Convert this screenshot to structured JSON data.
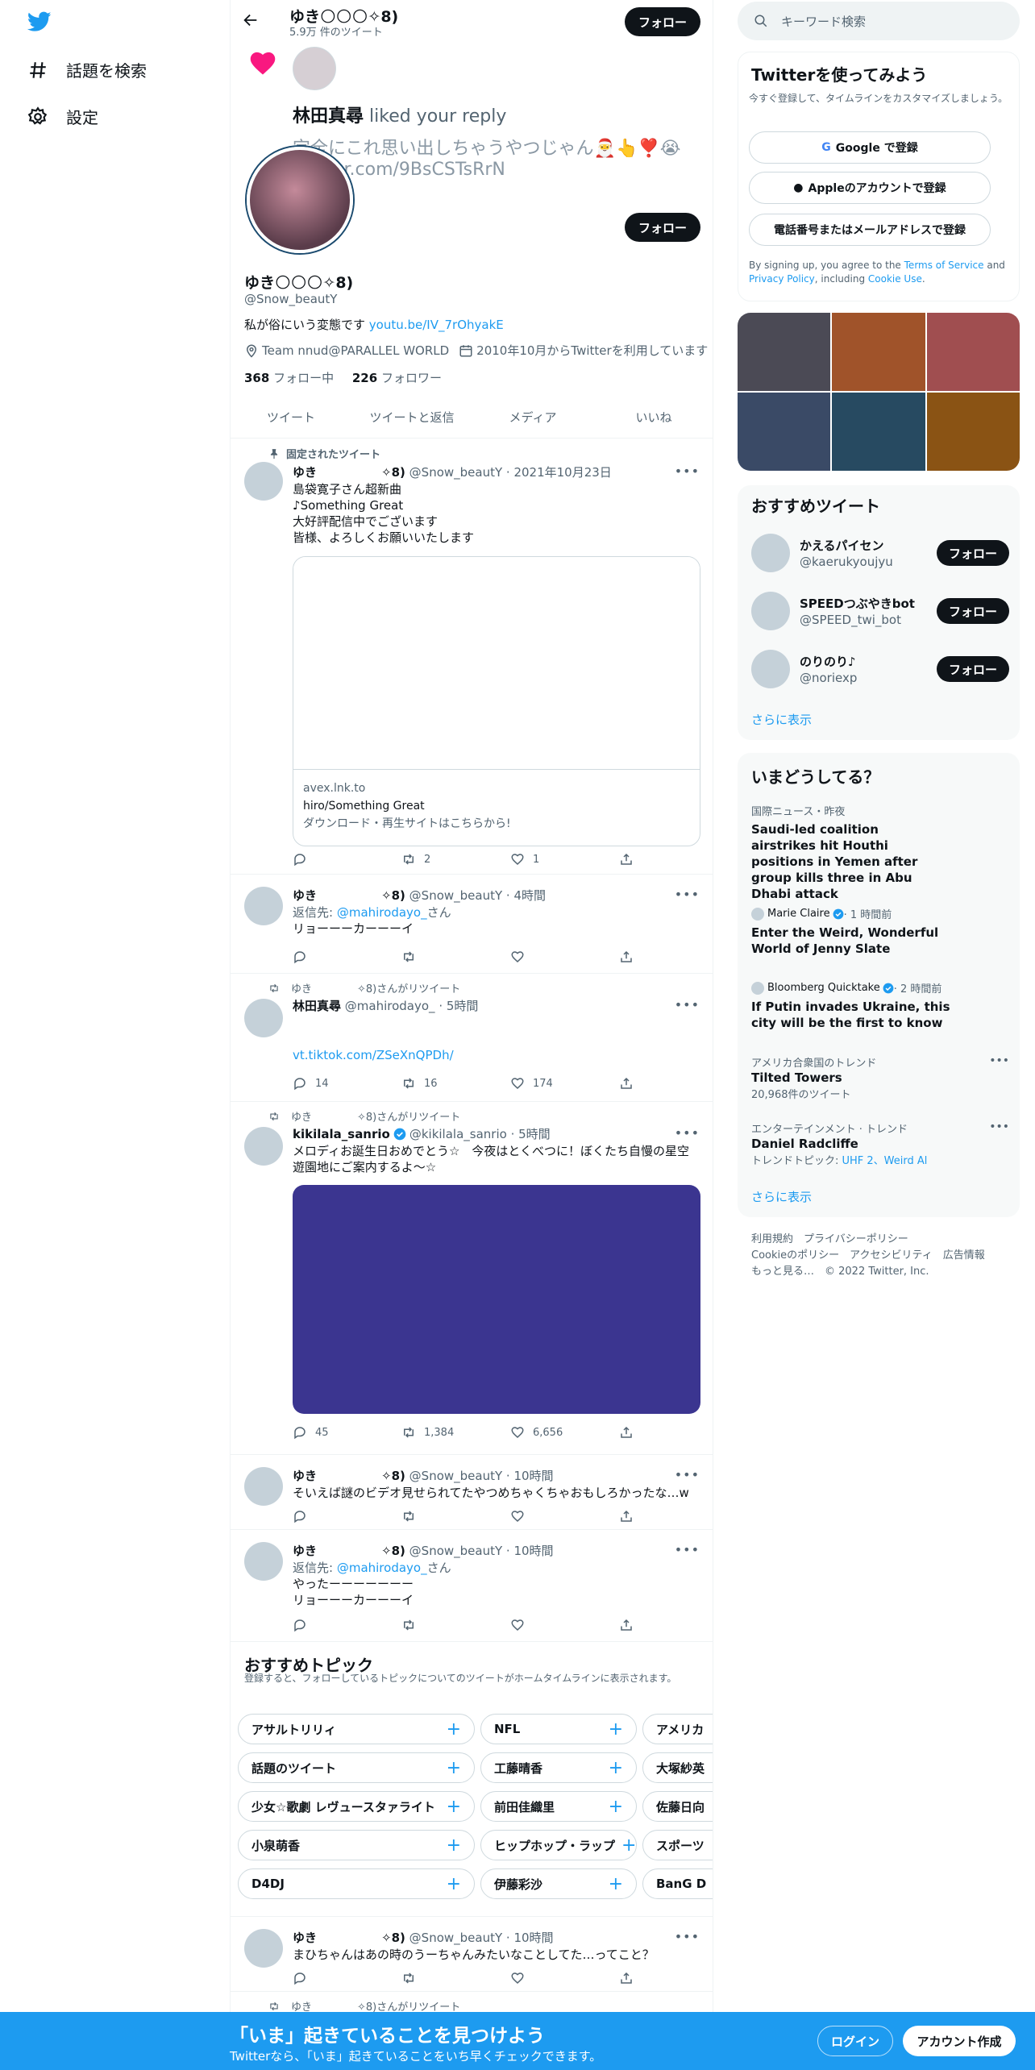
{
  "nav": {
    "explore_label": "話題を検索",
    "settings_label": "設定"
  },
  "profile": {
    "header_name": "ゆき🌕🌕🌕✧8)",
    "header_tweet_count": "5.9万 件のツイート",
    "follow_label": "フォロー",
    "notif_text_name": "林田真尋",
    "notif_text_rest": " liked your reply",
    "notif_tweet_text": "完全にこれ思い出しちゃうやつじゃん🎅👆❣️😭",
    "notif_link": "twitter.com/9BsCSTsRrN",
    "name": "ゆき🌕🌕🌕✧8)",
    "handle": "@Snow_beautY",
    "bio_text": "私が俗にいう変態です ",
    "bio_link": "youtu.be/IV_7rOhyakE",
    "location": "Team nnud@PARALLEL WORLD",
    "joined": "2010年10月からTwitterを利用しています",
    "following_count": "368",
    "following_label": " フォロー中",
    "followers_count": "226",
    "followers_label": " フォロワー"
  },
  "tabs": [
    "ツイート",
    "ツイートと返信",
    "メディア",
    "いいね"
  ],
  "tweets": {
    "pinned": {
      "pinned_label": "固定されたツイート",
      "name": "ゆき",
      "name_suffix": "✧8)",
      "handle_time": "@Snow_beautY · 2021年10月23日",
      "lines": [
        "島袋寛子さん超新曲",
        "♪Something Great",
        "大好評配信中でございます",
        "皆様、よろしくお願いいたします"
      ],
      "card_domain": "avex.lnk.to",
      "card_title": "hiro/Something Great",
      "card_desc": "ダウンロード・再生サイトはこちらから!",
      "retweets": "2",
      "likes": "1"
    },
    "t2": {
      "name": "ゆき",
      "name_suffix": "✧8)",
      "handle_time": "@Snow_beautY · 4時間",
      "reply_prefix": "返信先: ",
      "reply_to": "@mahirodayo_",
      "reply_suffix": "さん",
      "text": "リョーーーカーーーイ"
    },
    "t3": {
      "rt_label_a": "ゆき",
      "rt_label_b": "✧8)さんがリツイート",
      "name": "林田真尋",
      "handle_time": "@mahirodayo_ · 5時間",
      "link": "vt.tiktok.com/ZSeXnQPDh/",
      "replies": "14",
      "retweets": "16",
      "likes": "174"
    },
    "t4": {
      "rt_label_a": "ゆき",
      "rt_label_b": "✧8)さんがリツイート",
      "name": "kikilala_sanrio",
      "handle_time": "@kikilala_sanrio · 5時間",
      "line1": "メロディお誕生日おめでとう☆　今夜はとくべつに！ぼくたち自慢の星空",
      "line2": "遊園地にご案内するよ〜☆",
      "replies": "45",
      "retweets": "1,384",
      "likes": "6,656",
      "media_color": "#3b3590"
    },
    "t5": {
      "name": "ゆき",
      "name_suffix": "✧8)",
      "handle_time": "@Snow_beautY · 10時間",
      "text": "そいえば謎のビデオ見せられてたやつめちゃくちゃおもしろかったな…w"
    },
    "t6": {
      "name": "ゆき",
      "name_suffix": "✧8)",
      "handle_time": "@Snow_beautY · 10時間",
      "reply_prefix": "返信先: ",
      "reply_to": "@mahirodayo_",
      "reply_suffix": "さん",
      "line1": "やったーーーーーーー",
      "line2": "リョーーーカーーーイ"
    },
    "t7": {
      "name": "ゆき",
      "name_suffix": "✧8)",
      "handle_time": "@Snow_beautY · 10時間",
      "text": "まひちゃんはあの時のうーちゃんみたいなことしてた…ってこと？"
    },
    "t8": {
      "rt_label_a": "ゆき",
      "rt_label_b": "✧8)さんがリツイート"
    }
  },
  "topics": {
    "title": "おすすめトピック",
    "subtitle": "登録すると、フォローしているトピックについてのツイートがホームタイムラインに表示されます。",
    "col1": [
      "アサルトリリィ",
      "話題のツイート",
      "少女☆歌劇 レヴュースタァライト",
      "小泉萌香",
      "D4DJ"
    ],
    "col2": [
      "NFL",
      "工藤晴香",
      "前田佳織里",
      "ヒップホップ・ラップ",
      "伊藤彩沙"
    ],
    "col3": [
      "アメリカ",
      "大塚紗英",
      "佐藤日向",
      "スポーツ",
      "BanG D"
    ]
  },
  "right": {
    "search_placeholder": "キーワード検索",
    "signup_title": "Twitterを使ってみよう",
    "signup_sub": "今すぐ登録して、タイムラインをカスタマイズしましょう。",
    "google_btn": "Google で登録",
    "apple_btn": "Appleのアカウントで登録",
    "phone_btn": "電話番号またはメールアドレスで登録",
    "terms_a": "By signing up, you agree to the ",
    "terms_link1": "Terms of Service",
    "terms_b": " and ",
    "terms_link2": "Privacy Policy",
    "terms_c": ", including ",
    "terms_link3": "Cookie Use",
    "terms_d": ".",
    "media_colors": [
      "#4b4a55",
      "#a0532a",
      "#a04e50",
      "#3a4a66",
      "#274a61",
      "#8a5314"
    ],
    "wtf_title": "おすすめツイート",
    "wtf": [
      {
        "name": "かえるパイセン",
        "handle": "@kaerukyoujyu"
      },
      {
        "name": "SPEEDつぶやきbot",
        "handle": "@SPEED_twi_bot"
      },
      {
        "name": "のりのり♪",
        "handle": "@noriexp"
      }
    ],
    "show_more": "さらに表示",
    "trends_title": "いまどうしてる？",
    "trend1_cat": "国際ニュース・昨夜",
    "trend1_text": "Saudi-led coalition airstrikes hit Houthi positions in Yemen after group kills three in Abu Dhabi attack",
    "trend2_src": "Marie Claire",
    "trend2_time": " · 1 時間前",
    "trend2_text": "Enter the Weird, Wonderful World of Jenny Slate",
    "trend3_src": "Bloomberg Quicktake",
    "trend3_time": " · 2 時間前",
    "trend3_text": "If Putin invades Ukraine, this city will be the first to know",
    "trend4_cat": "アメリカ合衆国のトレンド",
    "trend4_name": "Tilted Towers",
    "trend4_count": "20,968件のツイート",
    "trend5_cat": "エンターテインメント · トレンド",
    "trend5_name": "Daniel Radcliffe",
    "trend5_topic_label": "トレンドトピック: ",
    "trend5_topics": "UHF 2、Weird Al",
    "footer_line1": "利用規約　プライバシーポリシー",
    "footer_line2": "Cookieのポリシー　アクセシビリティ　広告情報",
    "footer_line3": "もっと見る…　© 2022 Twitter, Inc."
  },
  "bottombar": {
    "title": "「いま」起きていることを見つけよう",
    "subtitle": "Twitterなら、「いま」起きていることをいち早くチェックできます。",
    "login_label": "ログイン",
    "signup_label": "アカウント作成"
  },
  "colors": {
    "accent": "#1d9bf0",
    "like": "#f91880",
    "bottombar": "#1d9bf0"
  }
}
